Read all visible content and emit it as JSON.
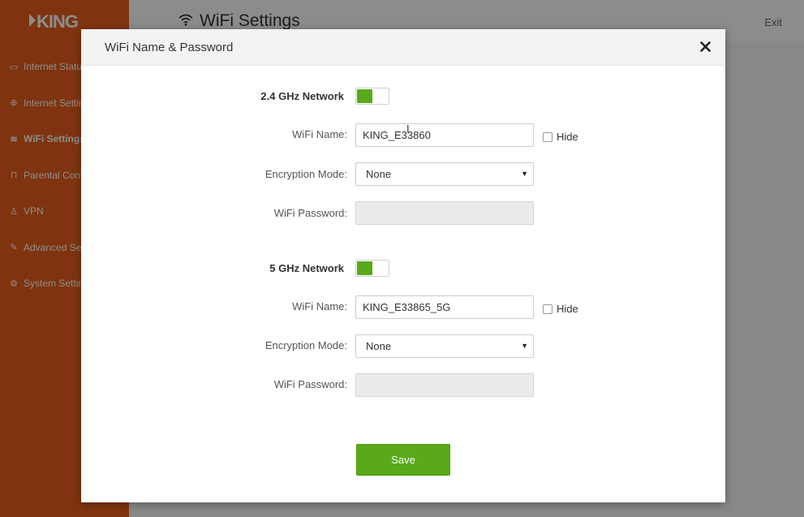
{
  "app": {
    "logo": "KING",
    "page_title": "WiFi Settings",
    "exit_label": "Exit"
  },
  "sidebar": {
    "items": [
      {
        "label": "Internet Status",
        "icon": "monitor-icon"
      },
      {
        "label": "Internet Settings",
        "icon": "globe-icon"
      },
      {
        "label": "WiFi Settings",
        "icon": "wifi-icon",
        "active": true
      },
      {
        "label": "Parental Controls",
        "icon": "lock-icon"
      },
      {
        "label": "VPN",
        "icon": "person-icon"
      },
      {
        "label": "Advanced Settings",
        "icon": "wrench-icon"
      },
      {
        "label": "System Settings",
        "icon": "gear-icon"
      }
    ]
  },
  "modal": {
    "title": "WiFi Name & Password",
    "close_label": "✕",
    "networks": [
      {
        "header": "2.4 GHz Network",
        "enabled": true,
        "wifi_name_label": "WiFi Name:",
        "wifi_name_value": "KING_E33860",
        "hide_label": "Hide",
        "hide_checked": false,
        "encryption_label": "Encryption Mode:",
        "encryption_value": "None",
        "password_label": "WiFi Password:",
        "password_value": ""
      },
      {
        "header": "5 GHz Network",
        "enabled": true,
        "wifi_name_label": "WiFi Name:",
        "wifi_name_value": "KING_E33865_5G",
        "hide_label": "Hide",
        "hide_checked": false,
        "encryption_label": "Encryption Mode:",
        "encryption_value": "None",
        "password_label": "WiFi Password:",
        "password_value": ""
      }
    ],
    "save_label": "Save"
  },
  "colors": {
    "sidebar": "#e8601c",
    "accent_green": "#5aa91a"
  }
}
